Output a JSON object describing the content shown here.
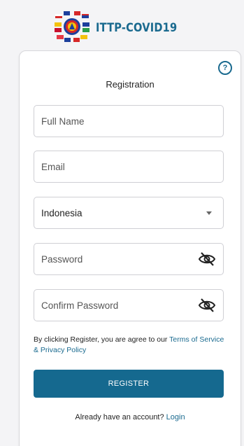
{
  "header": {
    "app_title": "ITTP-COVID19",
    "logo_icon": "flags-emblem-icon"
  },
  "card": {
    "title": "Registration",
    "help_icon": "?"
  },
  "form": {
    "full_name": {
      "placeholder": "Full Name",
      "value": ""
    },
    "email": {
      "placeholder": "Email",
      "value": ""
    },
    "country": {
      "value": "Indonesia"
    },
    "password": {
      "placeholder": "Password",
      "value": ""
    },
    "confirm_password": {
      "placeholder": "Confirm Password",
      "value": ""
    }
  },
  "terms": {
    "prefix": "By clicking Register, you are agree to our ",
    "link": "Terms of Service & Privacy Policy"
  },
  "register_label": "REGISTER",
  "login": {
    "prompt": "Already have an account?",
    "link": "Login"
  },
  "colors": {
    "accent": "#15698f",
    "background": "#f4f4f6",
    "card": "#ffffff"
  }
}
